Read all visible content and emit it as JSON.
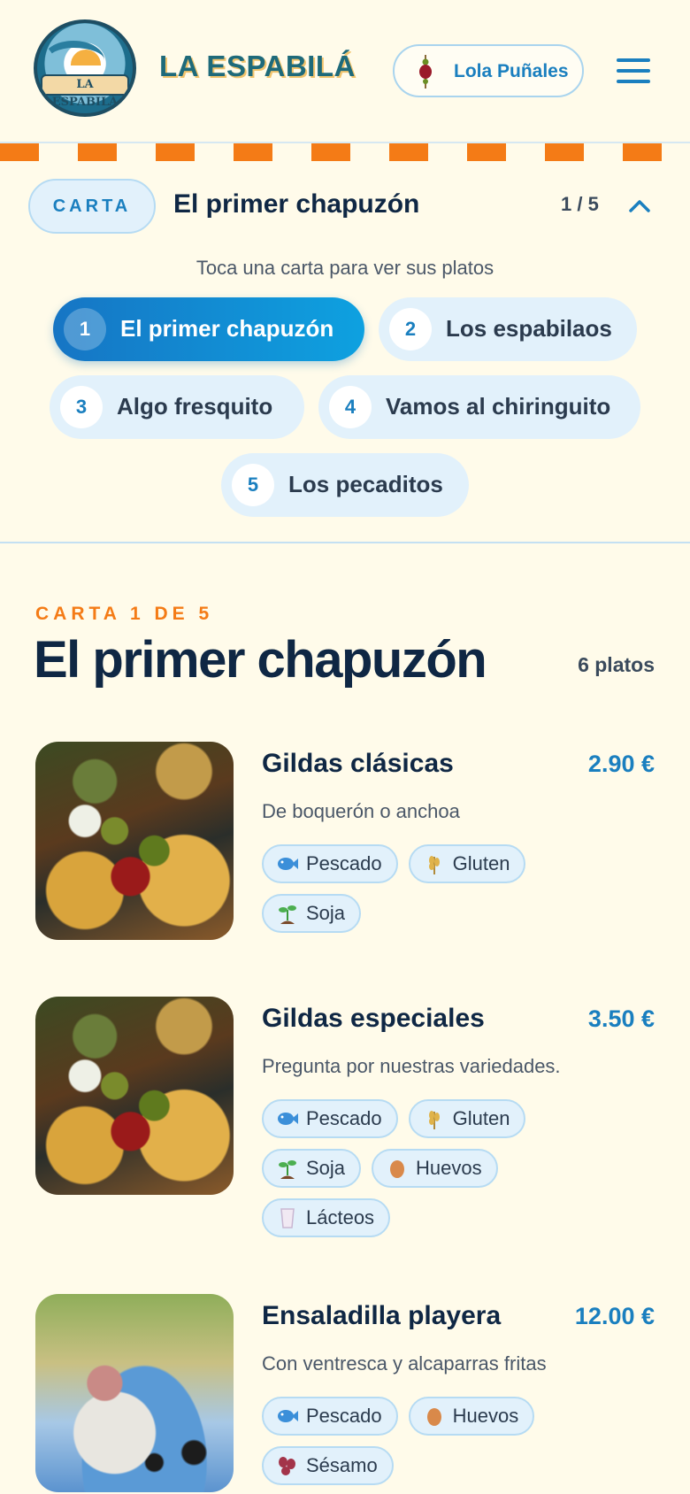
{
  "header": {
    "logo_text": "LA ESPABILÁ",
    "brand": "LA ESPABILÁ",
    "user_name": "Lola Puñales"
  },
  "selector": {
    "pill_label": "CARTA",
    "current_title": "El primer chapuzón",
    "pager": "1 / 5",
    "hint": "Toca una carta para ver sus platos",
    "chips": [
      {
        "num": "1",
        "label": "El primer chapuzón"
      },
      {
        "num": "2",
        "label": "Los espabilaos"
      },
      {
        "num": "3",
        "label": "Algo fresquito"
      },
      {
        "num": "4",
        "label": "Vamos al chiringuito"
      },
      {
        "num": "5",
        "label": "Los pecaditos"
      }
    ]
  },
  "section": {
    "eyebrow": "CARTA 1 DE 5",
    "title": "El primer chapuzón",
    "count": "6 platos"
  },
  "dishes": [
    {
      "name": "Gildas clásicas",
      "price": "2.90 €",
      "desc": "De boquerón o anchoa",
      "tags": [
        {
          "icon": "fish-icon",
          "label": "Pescado"
        },
        {
          "icon": "wheat-icon",
          "label": "Gluten"
        },
        {
          "icon": "sprout-icon",
          "label": "Soja"
        }
      ]
    },
    {
      "name": "Gildas especiales",
      "price": "3.50 €",
      "desc": "Pregunta por nuestras variedades.",
      "tags": [
        {
          "icon": "fish-icon",
          "label": "Pescado"
        },
        {
          "icon": "wheat-icon",
          "label": "Gluten"
        },
        {
          "icon": "sprout-icon",
          "label": "Soja"
        },
        {
          "icon": "egg-icon",
          "label": "Huevos"
        },
        {
          "icon": "milk-icon",
          "label": "Lácteos"
        }
      ]
    },
    {
      "name": "Ensaladilla playera",
      "price": "12.00 €",
      "desc": "Con ventresca y alcaparras fritas",
      "tags": [
        {
          "icon": "fish-icon",
          "label": "Pescado"
        },
        {
          "icon": "egg-icon",
          "label": "Huevos"
        },
        {
          "icon": "sesame-icon",
          "label": "Sésamo"
        }
      ]
    }
  ],
  "colors": {
    "background": "#fffbea",
    "accent_blue": "#1a7fbf",
    "accent_orange": "#f47b16",
    "navy": "#0f2744"
  }
}
